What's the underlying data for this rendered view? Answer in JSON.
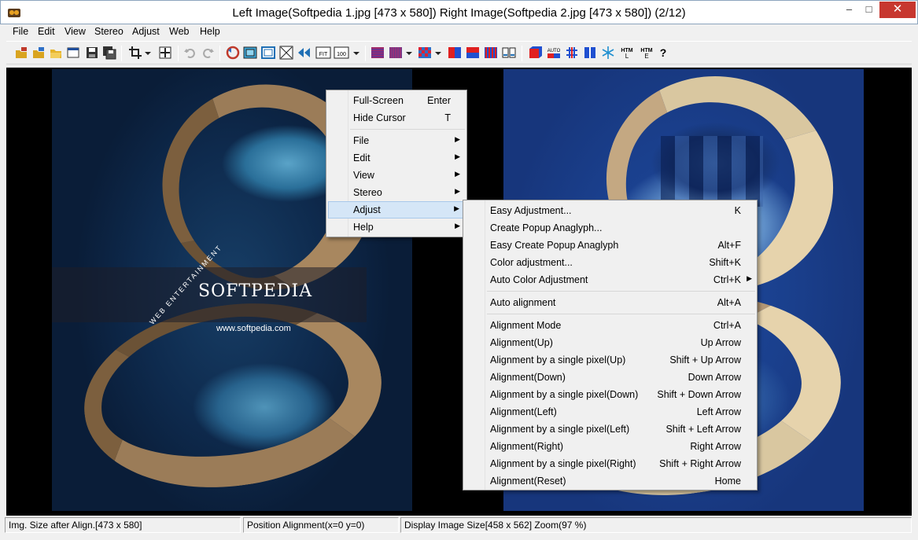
{
  "window": {
    "title": "Left Image(Softpedia 1.jpg [473 x 580])  Right Image(Softpedia 2.jpg [473 x 580])  (2/12)",
    "minimize_glyph": "–",
    "maximize_glyph": "□",
    "close_glyph": "✕"
  },
  "menubar": [
    "File",
    "Edit",
    "View",
    "Stereo",
    "Adjust",
    "Web",
    "Help"
  ],
  "toolbar": {
    "icons": [
      "open-left-icon",
      "open-right-icon",
      "open-folder-icon",
      "open-window-icon",
      "save-icon",
      "save-all-icon",
      "crop-icon",
      "crop-dropdown-icon",
      "move-icon",
      "undo-icon",
      "redo-icon",
      "swap-icon",
      "view-single-icon",
      "view-frame-icon",
      "fit-cross-icon",
      "flip-icon",
      "fit-icon",
      "zoom-100-icon",
      "zoom-dropdown-icon",
      "stereo-line-icon",
      "stereo-interlace-icon",
      "stereo-dropdown-icon",
      "stereo-checker-icon",
      "stereo-dropdown2-icon",
      "anaglyph-red-blue-icon",
      "anaglyph-red-blue2-icon",
      "stereo-columns-icon",
      "split-icon",
      "red-cube-icon",
      "auto-icon",
      "sharp-icon",
      "side-by-side-icon",
      "snowflake-icon",
      "html-icon",
      "html2-icon",
      "help-icon"
    ],
    "fit_label": "FIT",
    "zoom_label": "100",
    "auto_label": "AUTO",
    "htm_label": "HTM",
    "help_label": "?"
  },
  "watermark": {
    "brand": "SOFTPEDIA",
    "url": "www.softpedia.com",
    "sub": "WEB ENTERTAINMENT"
  },
  "context_menu": {
    "items": [
      {
        "label": "Full-Screen",
        "shortcut": "Enter"
      },
      {
        "label": "Hide Cursor",
        "shortcut": "T"
      },
      {
        "label": "File",
        "submenu": true
      },
      {
        "label": "Edit",
        "submenu": true
      },
      {
        "label": "View",
        "submenu": true
      },
      {
        "label": "Stereo",
        "submenu": true
      },
      {
        "label": "Adjust",
        "submenu": true
      },
      {
        "label": "Help",
        "submenu": true
      }
    ],
    "submenu_arrow": "▶"
  },
  "adjust_submenu": {
    "items": [
      {
        "label": "Easy Adjustment...",
        "shortcut": "K"
      },
      {
        "label": "Create Popup Anaglyph...",
        "shortcut": ""
      },
      {
        "label": "Easy Create Popup Anaglyph",
        "shortcut": "Alt+F"
      },
      {
        "label": "Color adjustment...",
        "shortcut": "Shift+K"
      },
      {
        "label": "Auto Color Adjustment",
        "shortcut": "Ctrl+K"
      },
      {
        "label": "Auto alignment",
        "shortcut": "Alt+A"
      },
      {
        "label": "Alignment Mode",
        "shortcut": "Ctrl+A"
      },
      {
        "label": "Alignment(Up)",
        "shortcut": "Up Arrow"
      },
      {
        "label": "Alignment by a single pixel(Up)",
        "shortcut": "Shift + Up Arrow"
      },
      {
        "label": "Alignment(Down)",
        "shortcut": "Down Arrow"
      },
      {
        "label": "Alignment by a single pixel(Down)",
        "shortcut": "Shift + Down Arrow"
      },
      {
        "label": "Alignment(Left)",
        "shortcut": "Left Arrow"
      },
      {
        "label": "Alignment by a single pixel(Left)",
        "shortcut": "Shift + Left Arrow"
      },
      {
        "label": "Alignment(Right)",
        "shortcut": "Right Arrow"
      },
      {
        "label": "Alignment by a single pixel(Right)",
        "shortcut": "Shift + Right Arrow"
      },
      {
        "label": "Alignment(Reset)",
        "shortcut": "Home"
      }
    ],
    "submenu_arrow": "▶"
  },
  "statusbar": {
    "img_size": "Img. Size after Align.[473 x 580]",
    "position": "Position Alignment(x=0 y=0)",
    "display": "Display Image Size[458 x 562]  Zoom(97 %)"
  }
}
